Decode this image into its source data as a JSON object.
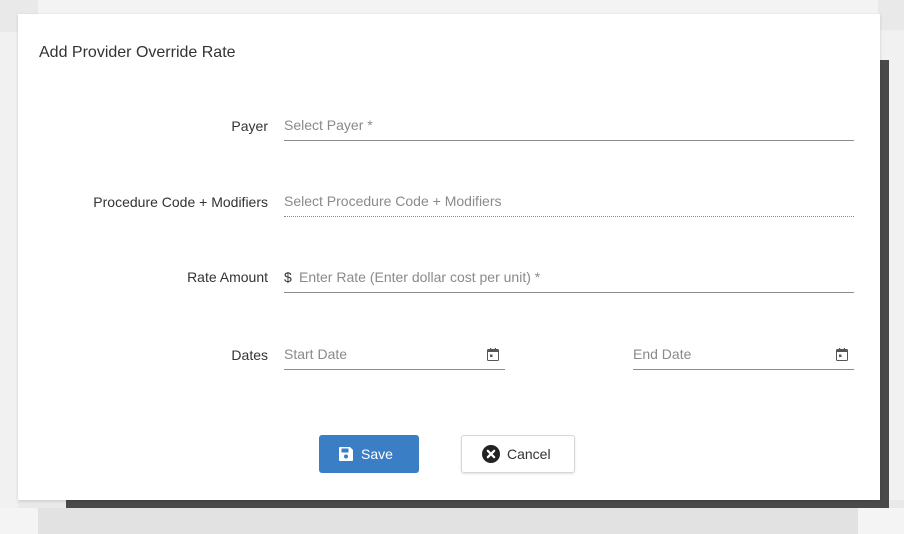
{
  "dialog": {
    "title": "Add Provider Override Rate"
  },
  "form": {
    "payer": {
      "label": "Payer",
      "placeholder": "Select Payer *"
    },
    "procedure": {
      "label": "Procedure Code + Modifiers",
      "placeholder": "Select Procedure Code + Modifiers"
    },
    "rate": {
      "label": "Rate Amount",
      "prefix": "$",
      "placeholder": "Enter Rate (Enter dollar cost per unit) *"
    },
    "dates": {
      "label": "Dates",
      "start_placeholder": "Start Date",
      "end_placeholder": "End Date",
      "icon": "calendar-icon"
    }
  },
  "buttons": {
    "save": {
      "label": "Save",
      "icon": "floppy-disk-icon",
      "color": "#3a7ec6"
    },
    "cancel": {
      "label": "Cancel",
      "icon": "close-circle-icon"
    }
  }
}
